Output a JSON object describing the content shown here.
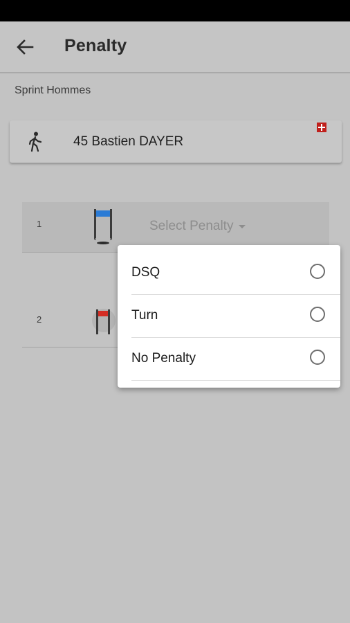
{
  "app_bar": {
    "title": "Penalty"
  },
  "category": "Sprint Hommes",
  "athlete": {
    "name": "45 Bastien DAYER",
    "icon": "walking-icon",
    "flag": "swiss-flag-icon",
    "flag_color": "#c0201c"
  },
  "gates": [
    {
      "number": "1",
      "color": "blue",
      "gate_color": "#2a7bd6",
      "select_label": "Select Penalty"
    },
    {
      "number": "2",
      "color": "red",
      "gate_color": "#d42d24"
    }
  ],
  "dropdown": {
    "options": [
      {
        "label": "DSQ",
        "selected": false
      },
      {
        "label": "Turn",
        "selected": false
      },
      {
        "label": "No Penalty",
        "selected": false
      }
    ]
  }
}
